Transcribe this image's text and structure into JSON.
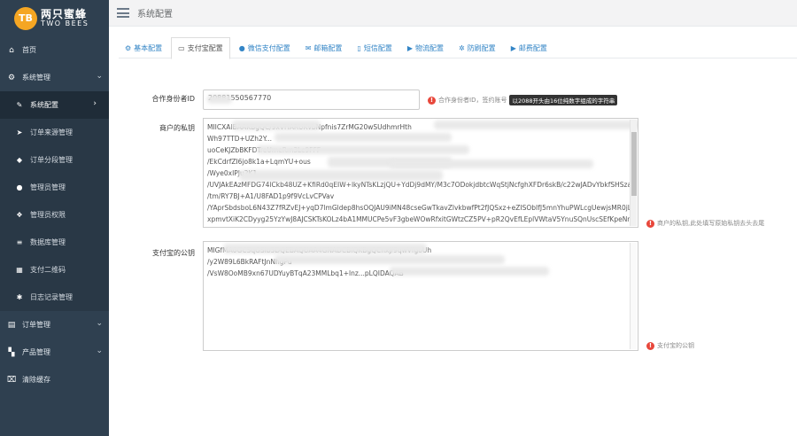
{
  "brand": {
    "badge": "TB",
    "name_cn": "两只蜜蜂",
    "name_en": "TWO BEES",
    "color": "#f5a623"
  },
  "sidebar": {
    "items": [
      {
        "icon": "home-icon",
        "glyph": "⌂",
        "label": "首页"
      },
      {
        "icon": "gear-icon",
        "glyph": "⚙",
        "label": "系统管理",
        "expanded": true
      }
    ],
    "subitems": [
      {
        "icon": "wrench-icon",
        "glyph": "✎",
        "label": "系统配置",
        "active": true
      },
      {
        "icon": "send-icon",
        "glyph": "➤",
        "label": "订单来源管理"
      },
      {
        "icon": "tag-icon",
        "glyph": "◆",
        "label": "订单分段管理"
      },
      {
        "icon": "user-icon",
        "glyph": "●",
        "label": "管理员管理"
      },
      {
        "icon": "users-icon",
        "glyph": "❖",
        "label": "管理员权限"
      },
      {
        "icon": "database-icon",
        "glyph": "≡",
        "label": "数据库管理"
      },
      {
        "icon": "qrcode-icon",
        "glyph": "▦",
        "label": "支付二维码"
      },
      {
        "icon": "log-icon",
        "glyph": "✱",
        "label": "日志记录管理"
      }
    ],
    "bottom_items": [
      {
        "icon": "order-icon",
        "glyph": "▤",
        "label": "订单管理",
        "chevron": true
      },
      {
        "icon": "product-icon",
        "glyph": "▚",
        "label": "产品管理",
        "chevron": true
      },
      {
        "icon": "clear-cache-icon",
        "glyph": "⌧",
        "label": "清除缓存"
      }
    ]
  },
  "topbar": {
    "title": "系统配置"
  },
  "tabs": [
    {
      "icon": "sliders-icon",
      "glyph": "⚙",
      "label": "基本配置"
    },
    {
      "icon": "card-icon",
      "glyph": "▭",
      "label": "支付宝配置",
      "active": true
    },
    {
      "icon": "wechat-icon",
      "glyph": "●",
      "label": "微信支付配置"
    },
    {
      "icon": "mail-icon",
      "glyph": "✉",
      "label": "邮箱配置"
    },
    {
      "icon": "mobile-icon",
      "glyph": "▯",
      "label": "短信配置"
    },
    {
      "icon": "truck-icon",
      "glyph": "▶",
      "label": "物流配置"
    },
    {
      "icon": "shield-icon",
      "glyph": "✲",
      "label": "防刷配置"
    },
    {
      "icon": "truck-icon",
      "glyph": "▶",
      "label": "邮费配置"
    }
  ],
  "form": {
    "partner_id": {
      "label": "合作身份者ID",
      "value": "20881550567770",
      "hint": "合作身份者ID，签约账号",
      "hint_tag": "以2088开头由16位纯数字组成的字符串"
    },
    "private_key": {
      "label": "商户的私钥",
      "hint": "商户的私钥,此处填写原始私钥去头去尾",
      "lines": [
        "MIICXAIBAAKBgQC/9xVHARUKvbNpfnis7ZrMG20wSUdhmrHth",
        "Wh97TTD+UZh2Y...",
        "uoCeKJZbBKFDTreUmeRm3Lc9FFF",
        "/EkCdrfZI6jo8k1a+LqmYU+ous",
        "/Wye0xIPJu2K1",
        "/UVJAkEAz MFDG74ICkb48U",
        "/UVJAkEAzMFDG74lCkb48UZ+KfiRd0qEIW+lkyNTsKLzjQU+YdDj9dMY/M3c7ODokjdbtcWqStjNcfghXFDr6skB/c22wJADvYbkfSHSza6f",
        "/tm/RY7BJ+A1/U8FAD1p9f9VcLvCPVav",
        "/YAprSbdsboL6N43Z7fRZvEJ+yqD7lmGldep8hsOQJAU9iMN48cseGwTkavZlvkbwfPt2fJQSxz+eZISObIfJ5mnYhuPWLcgUewjsMR0jLH98",
        "xpmvtXiK2CDyyg25YzYwJ8AJCSKTsKOLz4bA1MMUCPe5vF3gbeWOwRfxitGWtzCZ5PV+pR2QvEfLEplVWtaV5YnuSQnUscSEfKpeNnhYV"
      ]
    },
    "alipay_public_key": {
      "label": "支付宝的公钥",
      "hint": "支付宝的公钥",
      "lines": [
        "MIGfMA0GCSqGSIb3DQEBAQUAA4GNADCBiQKBgQCnxj/9qwVfgoUh",
        "/y2W89L6BkRAFtJnNhgPu",
        "/VsW8OoMB9xn67UDYuyBTqA23MMLbq1+lnz...pLQIDAQAB"
      ]
    }
  }
}
